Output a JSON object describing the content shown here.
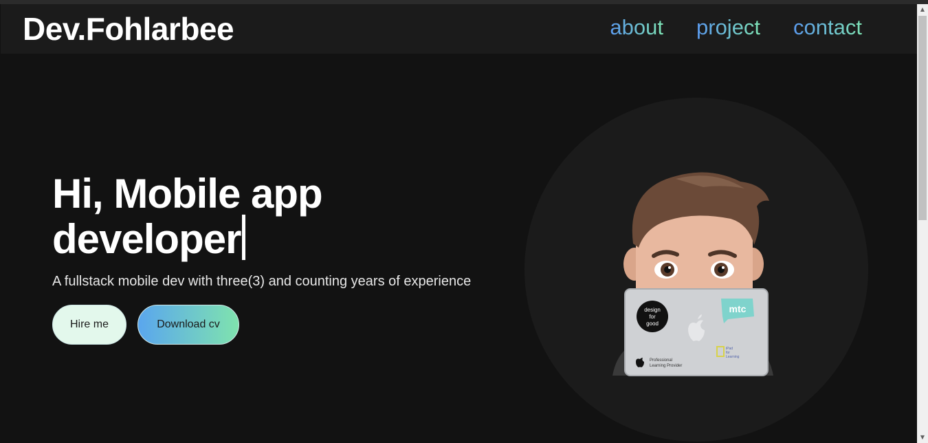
{
  "navbar": {
    "brand": "Dev.Fohlarbee",
    "links": [
      {
        "label": "about"
      },
      {
        "label": "project"
      },
      {
        "label": "contact"
      }
    ]
  },
  "hero": {
    "headline_line1": "Hi, Mobile app",
    "headline_line2": "developer",
    "subtitle": "A fullstack mobile dev with three(3) and counting years of experience",
    "hire_button": "Hire me",
    "cv_button": "Download cv"
  },
  "laptop_stickers": {
    "design_for_good": "design for good",
    "mtc": "mtc",
    "apple_provider_line1": "Professional",
    "apple_provider_line2": "Learning Provider",
    "ipad_learning": "iPad for Learning"
  },
  "colors": {
    "background": "#121212",
    "navbar": "#1b1b1b",
    "accent_blue": "#5b9bf0",
    "accent_green": "#7ee3b5"
  }
}
